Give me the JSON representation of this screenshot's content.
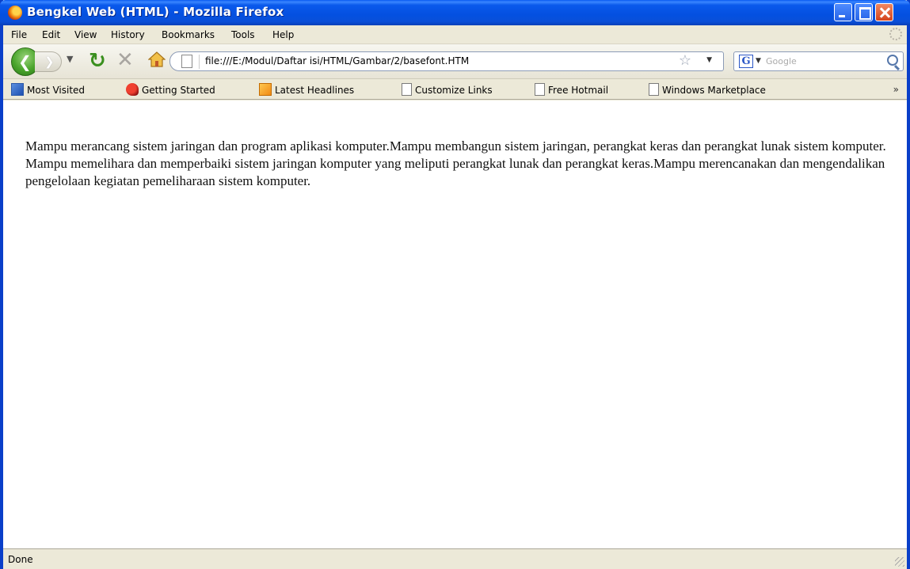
{
  "window": {
    "title": "Bengkel Web (HTML) - Mozilla Firefox"
  },
  "menu": {
    "items": [
      {
        "label": "File"
      },
      {
        "label": "Edit"
      },
      {
        "label": "View"
      },
      {
        "label": "History"
      },
      {
        "label": "Bookmarks"
      },
      {
        "label": "Tools"
      },
      {
        "label": "Help"
      }
    ]
  },
  "navbar": {
    "url": "file:///E:/Modul/Daftar isi/HTML/Gambar/2/basefont.HTM",
    "search_engine": "G",
    "search_placeholder": "Google"
  },
  "bookmarks": {
    "items": [
      {
        "label": "Most Visited",
        "icon": "most-visited-icon"
      },
      {
        "label": "Getting Started",
        "icon": "firefox-icon"
      },
      {
        "label": "Latest Headlines",
        "icon": "rss-feed-icon"
      },
      {
        "label": "Customize Links",
        "icon": "page-icon"
      },
      {
        "label": "Free Hotmail",
        "icon": "page-icon"
      },
      {
        "label": "Windows Marketplace",
        "icon": "page-icon"
      }
    ],
    "overflow": "»"
  },
  "content": {
    "paragraph": "Mampu merancang sistem jaringan dan program aplikasi komputer.Mampu membangun sistem jaringan, perangkat keras dan perangkat lunak sistem komputer. Mampu memelihara dan memperbaiki sistem jaringan komputer yang meliputi perangkat lunak dan perangkat keras.Mampu merencanakan dan mengendalikan pengelolaan kegiatan pemeliharaan sistem komputer."
  },
  "status": {
    "text": "Done"
  }
}
